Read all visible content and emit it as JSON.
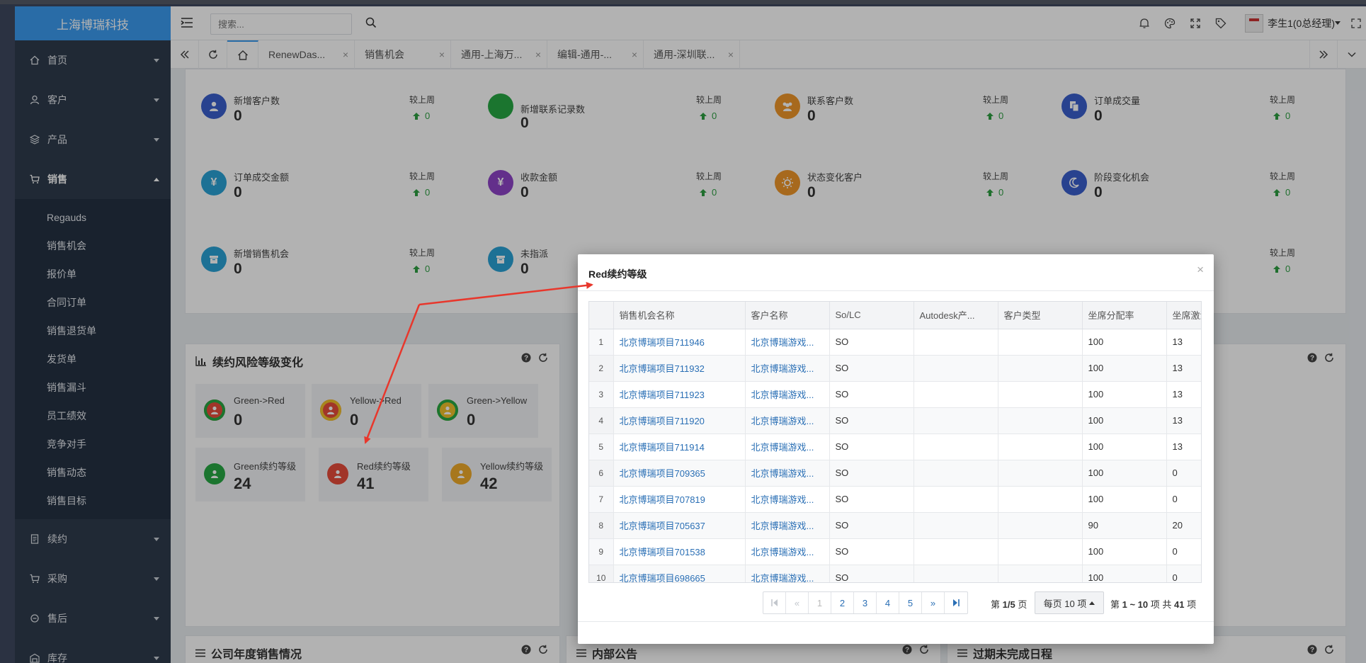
{
  "brand": "上海博瑞科技",
  "sidebar": {
    "items": [
      {
        "label": "首页",
        "icon": "home-icon"
      },
      {
        "label": "客户",
        "icon": "user-icon"
      },
      {
        "label": "产品",
        "icon": "cube-icon"
      },
      {
        "label": "销售",
        "icon": "cart-icon"
      }
    ],
    "sales_sub": [
      "Regauds",
      "销售机会",
      "报价单",
      "合同订单",
      "销售退货单",
      "发货单",
      "销售漏斗",
      "员工绩效",
      "竞争对手",
      "销售动态",
      "销售目标"
    ],
    "bottom_items": [
      {
        "label": "续约",
        "icon": "file-icon"
      },
      {
        "label": "采购",
        "icon": "cart-icon"
      },
      {
        "label": "售后",
        "icon": "circle-icon"
      },
      {
        "label": "库存",
        "icon": "warehouse-icon"
      }
    ]
  },
  "header": {
    "search_placeholder": "搜索...",
    "user_name": "李生1(0总经理)"
  },
  "tabs": [
    "RenewDas...",
    "销售机会",
    "通用-上海万...",
    "编辑-通用-...",
    "通用-深圳联..."
  ],
  "stats": [
    {
      "label": "新增客户数",
      "value": "0",
      "cmp_label": "较上周",
      "cmp_value": "0",
      "color": "#3a5fcd",
      "icon": "user-icon"
    },
    {
      "label": "新增联系记录数",
      "value": "0",
      "cmp_label": "较上周",
      "cmp_value": "0",
      "color": "#27a844",
      "icon": "circle-icon"
    },
    {
      "label": "联系客户数",
      "value": "0",
      "cmp_label": "较上周",
      "cmp_value": "0",
      "color": "#f0972a",
      "icon": "users-icon"
    },
    {
      "label": "订单成交量",
      "value": "0",
      "cmp_label": "较上周",
      "cmp_value": "0",
      "color": "#3a5fcd",
      "icon": "copy-icon"
    },
    {
      "label": "订单成交金额",
      "value": "0",
      "cmp_label": "较上周",
      "cmp_value": "0",
      "color": "#2aa3d6",
      "icon": "yen-icon"
    },
    {
      "label": "收款金额",
      "value": "0",
      "cmp_label": "较上周",
      "cmp_value": "0",
      "color": "#8e44c8",
      "icon": "yen-icon"
    },
    {
      "label": "状态变化客户",
      "value": "0",
      "cmp_label": "较上周",
      "cmp_value": "0",
      "color": "#f0972a",
      "icon": "sun-icon"
    },
    {
      "label": "阶段变化机会",
      "value": "0",
      "cmp_label": "较上周",
      "cmp_value": "0",
      "color": "#3a5fcd",
      "icon": "moon-icon"
    },
    {
      "label": "新增销售机会",
      "value": "0",
      "cmp_label": "较上周",
      "cmp_value": "0",
      "color": "#2aa3d6",
      "icon": "box-icon"
    },
    {
      "label": "未指派",
      "value": "0",
      "cmp_label": "",
      "cmp_value": "",
      "color": "#2aa3d6",
      "icon": "box-icon"
    }
  ],
  "stats_extra": [
    {
      "cmp_label": "较上周",
      "cmp_value": "0"
    }
  ],
  "risk_panel": {
    "title": "续约风险等级变化",
    "items": [
      {
        "label": "Green->Red",
        "value": "0",
        "color": "#e74c3c",
        "ring": "#27a844"
      },
      {
        "label": "Yellow->Red",
        "value": "0",
        "color": "#e74c3c",
        "ring": "#f0c02a"
      },
      {
        "label": "Green->Yellow",
        "value": "0",
        "color": "#f0c02a",
        "ring": "#27a844"
      },
      {
        "label": "Green续约等级",
        "value": "24",
        "color": "#27a844",
        "ring": "#27a844"
      },
      {
        "label": "Red续约等级",
        "value": "41",
        "color": "#e74c3c",
        "ring": "#e74c3c"
      },
      {
        "label": "Yellow续约等级",
        "value": "42",
        "color": "#f0ab2a",
        "ring": "#f0ab2a"
      }
    ]
  },
  "bottom_panels": [
    "公司年度销售情况",
    "内部公告",
    "过期未完成日程"
  ],
  "modal": {
    "title": "Red续约等级",
    "columns": [
      "销售机会名称",
      "客户名称",
      "So/LC",
      "Autodesk产...",
      "客户类型",
      "坐席分配率",
      "坐席激活"
    ],
    "rows": [
      {
        "no": "1",
        "name": "北京博瑞项目711946",
        "customer": "北京博瑞游戏...",
        "solc": "SO",
        "autodesk": "",
        "type": "",
        "rate": "100",
        "active": "13"
      },
      {
        "no": "2",
        "name": "北京博瑞项目711932",
        "customer": "北京博瑞游戏...",
        "solc": "SO",
        "autodesk": "",
        "type": "",
        "rate": "100",
        "active": "13"
      },
      {
        "no": "3",
        "name": "北京博瑞项目711923",
        "customer": "北京博瑞游戏...",
        "solc": "SO",
        "autodesk": "",
        "type": "",
        "rate": "100",
        "active": "13"
      },
      {
        "no": "4",
        "name": "北京博瑞项目711920",
        "customer": "北京博瑞游戏...",
        "solc": "SO",
        "autodesk": "",
        "type": "",
        "rate": "100",
        "active": "13"
      },
      {
        "no": "5",
        "name": "北京博瑞项目711914",
        "customer": "北京博瑞游戏...",
        "solc": "SO",
        "autodesk": "",
        "type": "",
        "rate": "100",
        "active": "13"
      },
      {
        "no": "6",
        "name": "北京博瑞项目709365",
        "customer": "北京博瑞游戏...",
        "solc": "SO",
        "autodesk": "",
        "type": "",
        "rate": "100",
        "active": "0"
      },
      {
        "no": "7",
        "name": "北京博瑞项目707819",
        "customer": "北京博瑞游戏...",
        "solc": "SO",
        "autodesk": "",
        "type": "",
        "rate": "100",
        "active": "0"
      },
      {
        "no": "8",
        "name": "北京博瑞项目705637",
        "customer": "北京博瑞游戏...",
        "solc": "SO",
        "autodesk": "",
        "type": "",
        "rate": "90",
        "active": "20"
      },
      {
        "no": "9",
        "name": "北京博瑞项目701538",
        "customer": "北京博瑞游戏...",
        "solc": "SO",
        "autodesk": "",
        "type": "",
        "rate": "100",
        "active": "0"
      },
      {
        "no": "10",
        "name": "北京博瑞项目698665",
        "customer": "北京博瑞游戏...",
        "solc": "SO",
        "autodesk": "",
        "type": "",
        "rate": "100",
        "active": "0"
      }
    ],
    "pager": {
      "pages": [
        "1",
        "2",
        "3",
        "4",
        "5"
      ],
      "first": "⏮",
      "prev": "«",
      "next": "»",
      "last": "⏭",
      "page_info_prefix": "第",
      "page_info_current": "1/5",
      "page_info_suffix": "页",
      "page_size": "每页 10 项",
      "range_prefix": "第",
      "range_value": "1 ~ 10",
      "range_mid": "项 共",
      "range_total": "41",
      "range_suffix": "项"
    }
  },
  "colors": {
    "brand": "#3c9bf0",
    "sidebar": "#2f3b4c",
    "link": "#2a6fb5",
    "arrow": "#e8372c"
  }
}
